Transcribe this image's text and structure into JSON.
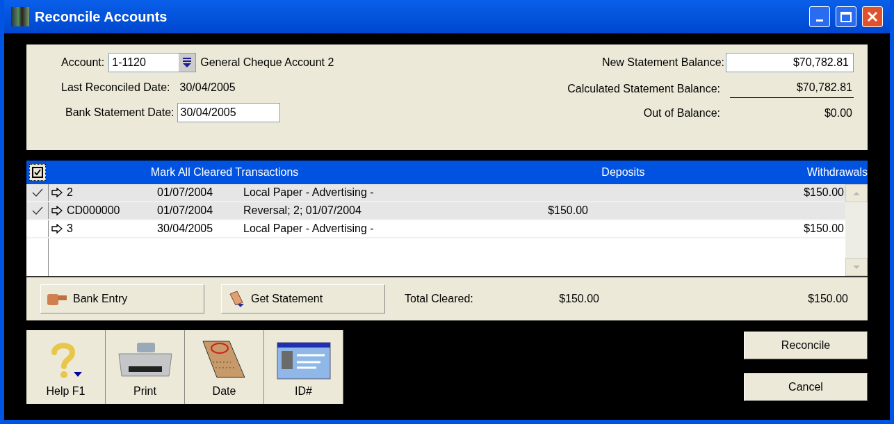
{
  "window": {
    "title": "Reconcile Accounts"
  },
  "account": {
    "label": "Account:",
    "value": "1-1120",
    "name": "General Cheque Account 2"
  },
  "last_reconciled": {
    "label": "Last Reconciled Date:",
    "value": "30/04/2005"
  },
  "bank_statement_date": {
    "label": "Bank Statement Date:",
    "value": "30/04/2005"
  },
  "new_statement_balance": {
    "label": "New Statement Balance:",
    "value": "$70,782.81"
  },
  "calculated_statement_balance": {
    "label": "Calculated Statement Balance:",
    "value": "$70,782.81"
  },
  "out_of_balance": {
    "label": "Out of Balance:",
    "value": "$0.00"
  },
  "table": {
    "mark_all": {
      "checked": true
    },
    "columns": [
      "Mark All Cleared Transactions",
      "Deposits",
      "Withdrawals"
    ],
    "rows": [
      {
        "checked": true,
        "id": "2",
        "date": "01/07/2004",
        "memo": "Local Paper - Advertising -",
        "deposit": "",
        "withdrawal": "$150.00"
      },
      {
        "checked": true,
        "id": "CD000000",
        "date": "01/07/2004",
        "memo": "Reversal; 2; 01/07/2004",
        "deposit": "$150.00",
        "withdrawal": ""
      },
      {
        "checked": false,
        "id": "3",
        "date": "30/04/2005",
        "memo": "Local Paper - Advertising -",
        "deposit": "",
        "withdrawal": "$150.00"
      }
    ]
  },
  "actions": [
    "Bank Entry",
    "Get Statement"
  ],
  "total_cleared": {
    "label": "Total Cleared:",
    "deposits": "$150.00",
    "withdrawals": "$150.00"
  },
  "toolbar": [
    {
      "kind": "help",
      "label": "Help F1"
    },
    {
      "kind": "print",
      "label": "Print"
    },
    {
      "kind": "date",
      "label": "Date"
    },
    {
      "kind": "id",
      "label": "ID#"
    }
  ],
  "buttons": [
    "Reconcile",
    "Cancel"
  ]
}
